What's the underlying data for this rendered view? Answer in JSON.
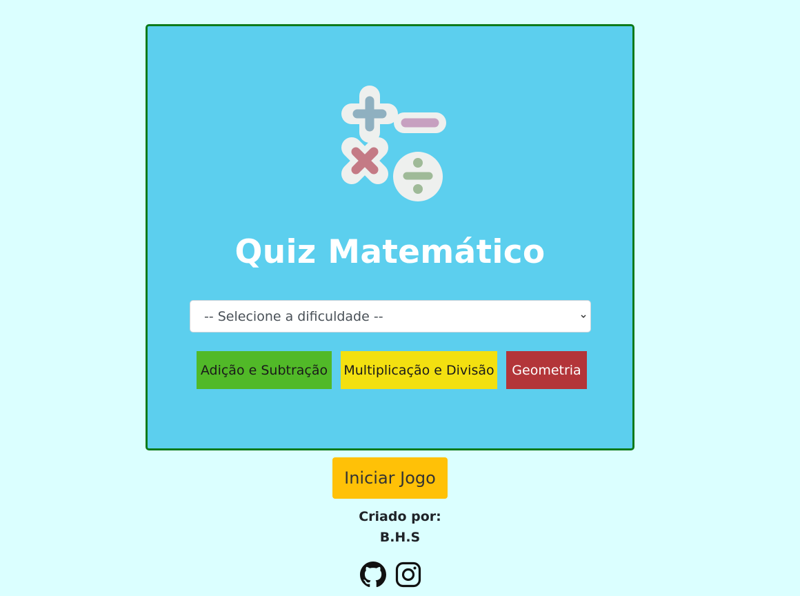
{
  "quiz": {
    "title": "Quiz Matemático",
    "logo_icon": "math-operators-icon",
    "difficulty_select": {
      "selected": "-- Selecione a dificuldade --"
    },
    "categories": [
      {
        "label": "Adição e Subtração",
        "color": "#51b928"
      },
      {
        "label": "Multiplicação e Divisão",
        "color": "#f3e010"
      },
      {
        "label": "Geometria",
        "color": "#b33539"
      }
    ]
  },
  "start_button": {
    "label": "Iniciar Jogo",
    "color": "#ffc107"
  },
  "footer": {
    "created_by_label": "Criado por:",
    "author": "B.H.S",
    "social_icons": [
      "github-icon",
      "instagram-icon"
    ]
  },
  "colors": {
    "background": "#dbffff",
    "panel": "#5ccfee",
    "panel_border": "#0d7a1a"
  }
}
